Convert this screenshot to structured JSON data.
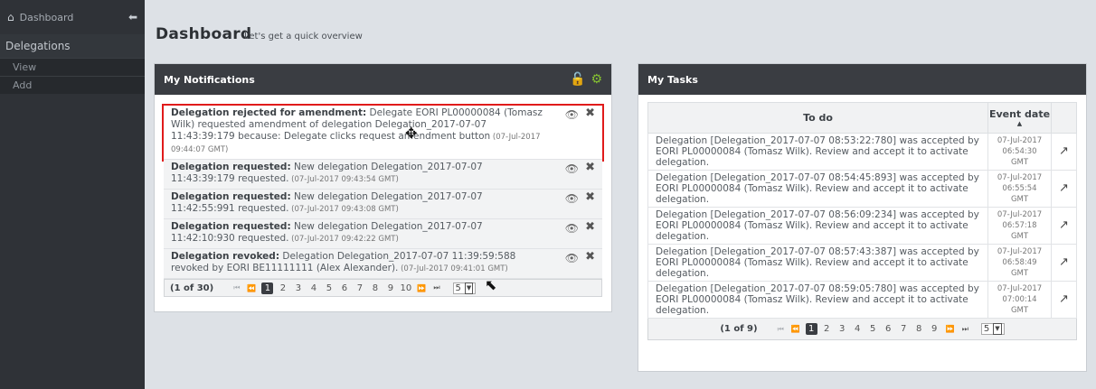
{
  "sidebar": {
    "top_label": "Dashboard",
    "section": "Delegations",
    "items": [
      "View",
      "Add"
    ]
  },
  "header": {
    "title": "Dashboard",
    "subtitle": "Let's get a quick overview"
  },
  "notifications": {
    "title": "My Notifications",
    "items": [
      {
        "head": "Delegation rejected for amendment:",
        "body": " Delegate EORI PL00000084 (Tomasz Wilk) requested amendment of delegation Delegation_2017-07-07 11:43:39:179 because: Delegate clicks request amendment button",
        "ts": " (07-Jul-2017 09:44:07 GMT)"
      },
      {
        "head": "Delegation requested:",
        "body": " New delegation Delegation_2017-07-07 11:43:39:179 requested.",
        "ts": " (07-Jul-2017 09:43:54 GMT)"
      },
      {
        "head": "Delegation requested:",
        "body": " New delegation Delegation_2017-07-07 11:42:55:991 requested.",
        "ts": " (07-Jul-2017 09:43:08 GMT)"
      },
      {
        "head": "Delegation requested:",
        "body": " New delegation Delegation_2017-07-07 11:42:10:930 requested.",
        "ts": " (07-Jul-2017 09:42:22 GMT)"
      },
      {
        "head": "Delegation revoked:",
        "body": " Delegation Delegation_2017-07-07 11:39:59:588 revoked by EORI BE11111111 (Alex Alexander).",
        "ts": " (07-Jul-2017 09:41:01 GMT)"
      }
    ],
    "pager": {
      "count": "(1 of 30)",
      "pages": [
        "1",
        "2",
        "3",
        "4",
        "5",
        "6",
        "7",
        "8",
        "9",
        "10"
      ],
      "per_page": "5"
    }
  },
  "tasks": {
    "title": "My Tasks",
    "col_todo": "To do",
    "col_date": "Event date",
    "rows": [
      {
        "text": "Delegation [Delegation_2017-07-07 08:53:22:780] was accepted by EORI PL00000084 (Tomasz Wilk). Review and accept it to activate delegation.",
        "date1": "07-Jul-2017",
        "date2": "06:54:30 GMT"
      },
      {
        "text": "Delegation [Delegation_2017-07-07 08:54:45:893] was accepted by EORI PL00000084 (Tomasz Wilk). Review and accept it to activate delegation.",
        "date1": "07-Jul-2017",
        "date2": "06:55:54 GMT"
      },
      {
        "text": "Delegation [Delegation_2017-07-07 08:56:09:234] was accepted by EORI PL00000084 (Tomasz Wilk). Review and accept it to activate delegation.",
        "date1": "07-Jul-2017",
        "date2": "06:57:18 GMT"
      },
      {
        "text": "Delegation [Delegation_2017-07-07 08:57:43:387] was accepted by EORI PL00000084 (Tomasz Wilk). Review and accept it to activate delegation.",
        "date1": "07-Jul-2017",
        "date2": "06:58:49 GMT"
      },
      {
        "text": "Delegation [Delegation_2017-07-07 08:59:05:780] was accepted by EORI PL00000084 (Tomasz Wilk). Review and accept it to activate delegation.",
        "date1": "07-Jul-2017",
        "date2": "07:00:14 GMT"
      }
    ],
    "pager": {
      "count": "(1 of 9)",
      "pages": [
        "1",
        "2",
        "3",
        "4",
        "5",
        "6",
        "7",
        "8",
        "9"
      ],
      "per_page": "5"
    }
  },
  "colors": {
    "accent": "#86c232",
    "highlight": "#e01b1b",
    "header_dark": "#3a3d42"
  }
}
